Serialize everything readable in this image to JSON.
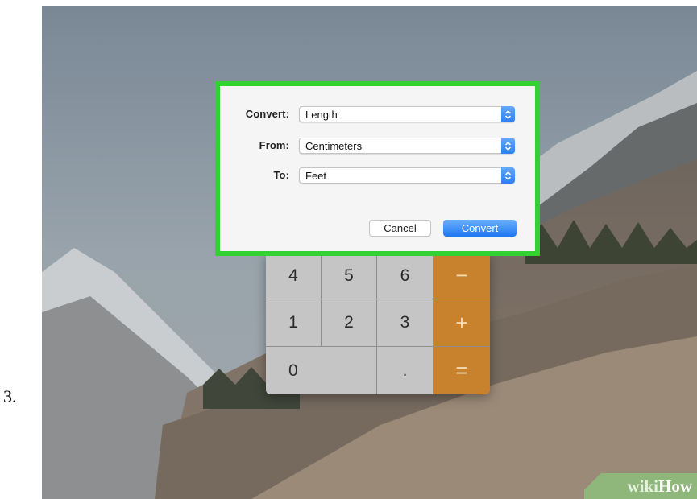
{
  "step": {
    "number": "3."
  },
  "dialog": {
    "rows": [
      {
        "label": "Convert:",
        "value": "Length"
      },
      {
        "label": "From:",
        "value": "Centimeters"
      },
      {
        "label": "To:",
        "value": "Feet"
      }
    ],
    "cancel_label": "Cancel",
    "convert_label": "Convert"
  },
  "calculator": {
    "keys": [
      "4",
      "5",
      "6",
      "−",
      "1",
      "2",
      "3",
      "+",
      "0",
      ".",
      "="
    ]
  },
  "watermark": {
    "part1": "wiki",
    "part2": "How"
  },
  "colors": {
    "highlight": "#32d233",
    "operator": "#c8822d",
    "accent": "#1e78f3"
  }
}
